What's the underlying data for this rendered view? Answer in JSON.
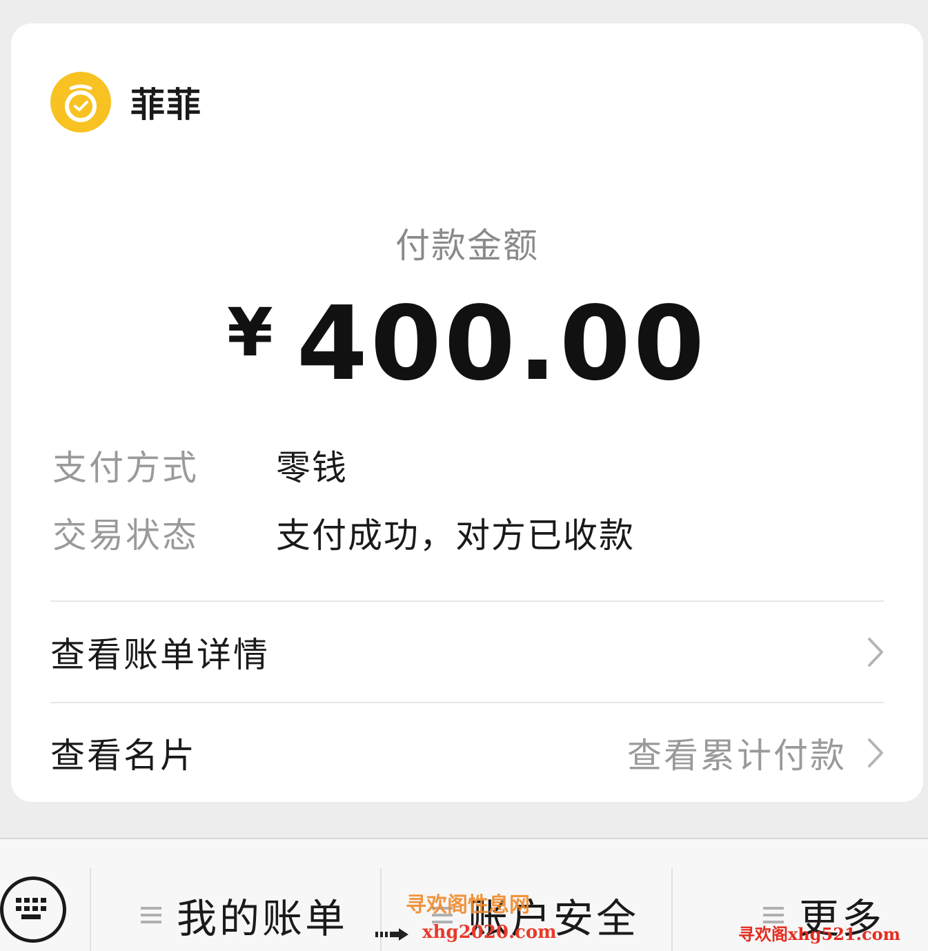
{
  "merchant": {
    "name": "菲菲",
    "logo_icon": "yellow-wallet-icon"
  },
  "payment": {
    "amount_label": "付款金额",
    "currency_symbol": "¥",
    "amount": "400.00"
  },
  "details": {
    "method_key": "支付方式",
    "method_value": "零钱",
    "status_key": "交易状态",
    "status_value": "支付成功，对方已收款"
  },
  "links": {
    "bill_details": "查看账单详情",
    "business_card": "查看名片",
    "cumulative_payment": "查看累计付款"
  },
  "bottom_menu": {
    "items": [
      {
        "label": "我的账单",
        "icon": "menu-icon"
      },
      {
        "label": "账户安全",
        "icon": "menu-icon"
      },
      {
        "label": "更多",
        "icon": "menu-icon"
      }
    ]
  },
  "watermarks": {
    "top_text": "寻欢阁性息网",
    "site": "xhg2020.com",
    "right_text": "寻欢阁xhg521.com"
  },
  "colors": {
    "logo": "#f7c222",
    "background": "#ededed",
    "card": "#ffffff"
  }
}
